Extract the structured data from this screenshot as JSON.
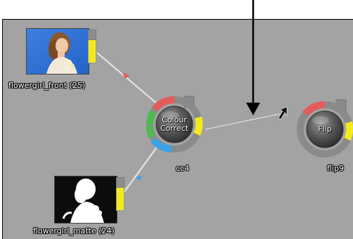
{
  "colors": {
    "canvas": "#a3a3a3",
    "wire": "#e6e6e6",
    "port_yellow": "#f3ea1d",
    "ring_red": "#e35c5c",
    "ring_green": "#4fba4f",
    "ring_blue": "#3aa2e8",
    "ring_yellow": "#f3ea1d",
    "ring_grey": "#8a8a8a",
    "ball": "#4a4a4a",
    "callout_arrow": "#000000"
  },
  "nodes": {
    "source_front": {
      "label": "flowergirl_front (25)",
      "thumbnail": "photo-of-girl-on-blue-background"
    },
    "source_matte": {
      "label": "flowergirl_matte (24)",
      "thumbnail": "white-silhouette-matte-on-black"
    },
    "colour_correct": {
      "title_line1": "Colour",
      "title_line2": "Correct",
      "name": "cc4"
    },
    "flip": {
      "title": "Flip",
      "name": "flip9"
    }
  },
  "icons": {
    "cursor": "mouse-pointer-icon",
    "callout": "down-arrow-callout-icon"
  }
}
